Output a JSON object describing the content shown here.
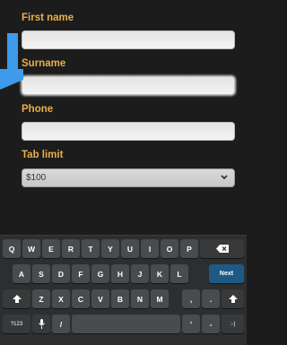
{
  "form": {
    "first_name_label": "First name",
    "surname_label": "Surname",
    "phone_label": "Phone",
    "tab_limit_label": "Tab limit",
    "tab_limit_value": "$100"
  },
  "keyboard": {
    "row1": [
      "Q",
      "W",
      "E",
      "R",
      "T",
      "Y",
      "U",
      "I",
      "O",
      "P"
    ],
    "row2": [
      "A",
      "S",
      "D",
      "F",
      "G",
      "H",
      "J",
      "K",
      "L"
    ],
    "row3": [
      "Z",
      "X",
      "C",
      "V",
      "B",
      "N",
      "M"
    ],
    "next_label": "Next",
    "symbols_label": "?123",
    "slash_label": "/",
    "apostrophe_label": "'",
    "dash_label": "-",
    "emoticon_label": ":-)",
    "comma_label": ",",
    "period_label": "."
  },
  "colors": {
    "label": "#e8b04a",
    "background": "#1c1c1c",
    "keyboard": "#2d2e30",
    "next_key": "#1f5a86",
    "callout": "#3d9be9"
  }
}
